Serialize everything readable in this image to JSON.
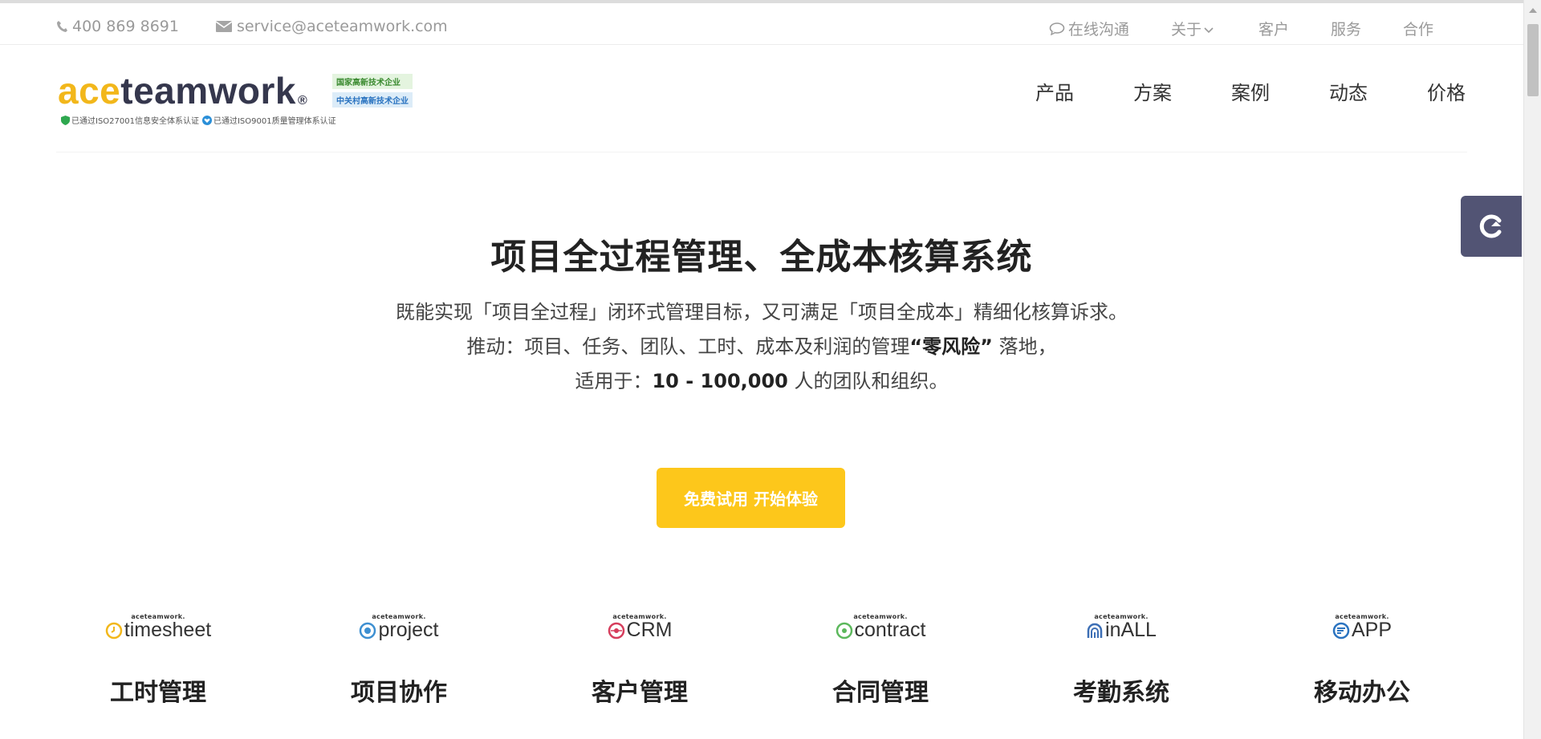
{
  "topbar": {
    "phone": "400 869 8691",
    "email": "service@aceteamwork.com",
    "links": [
      "在线沟通",
      "关于",
      "客户",
      "服务",
      "合作"
    ]
  },
  "logo": {
    "ace": "ace",
    "rest": "teamwork",
    "reg": "®",
    "badges": [
      "国家高新技术企业",
      "中关村高新技术企业"
    ],
    "certs": [
      "已通过ISO27001信息安全体系认证",
      "已通过ISO9001质量管理体系认证"
    ]
  },
  "nav": {
    "items": [
      "产品",
      "方案",
      "案例",
      "动态",
      "价格"
    ]
  },
  "hero": {
    "title": "项目全过程管理、全成本核算系统",
    "line1": "既能实现「项目全过程」闭环式管理目标，又可满足「项目全成本」精细化核算诉求。",
    "line2_pre": "推动：项目、任务、团队、工时、成本及利润的管理",
    "line2_bold": "“零风险”",
    "line2_post": " 落地，",
    "line3_pre": "适用于：",
    "line3_bold": "10 - 100,000",
    "line3_post": " 人的团队和组织。",
    "cta": "免费试用 开始体验"
  },
  "products": [
    {
      "small": "aceteamwork.",
      "brand": "timesheet",
      "title": "工时管理",
      "color": "#f2b71b"
    },
    {
      "small": "aceteamwork.",
      "brand": "project",
      "title": "项目协作",
      "color": "#3d8fd1"
    },
    {
      "small": "aceteamwork.",
      "brand": "CRM",
      "title": "客户管理",
      "color": "#d63d5c"
    },
    {
      "small": "aceteamwork.",
      "brand": "contract",
      "title": "合同管理",
      "color": "#5cb85c"
    },
    {
      "small": "aceteamwork.",
      "brand": "inALL",
      "title": "考勤系统",
      "color": "#3d6fb5"
    },
    {
      "small": "aceteamwork.",
      "brand": "APP",
      "title": "移动办公",
      "color": "#2a73c0"
    }
  ]
}
